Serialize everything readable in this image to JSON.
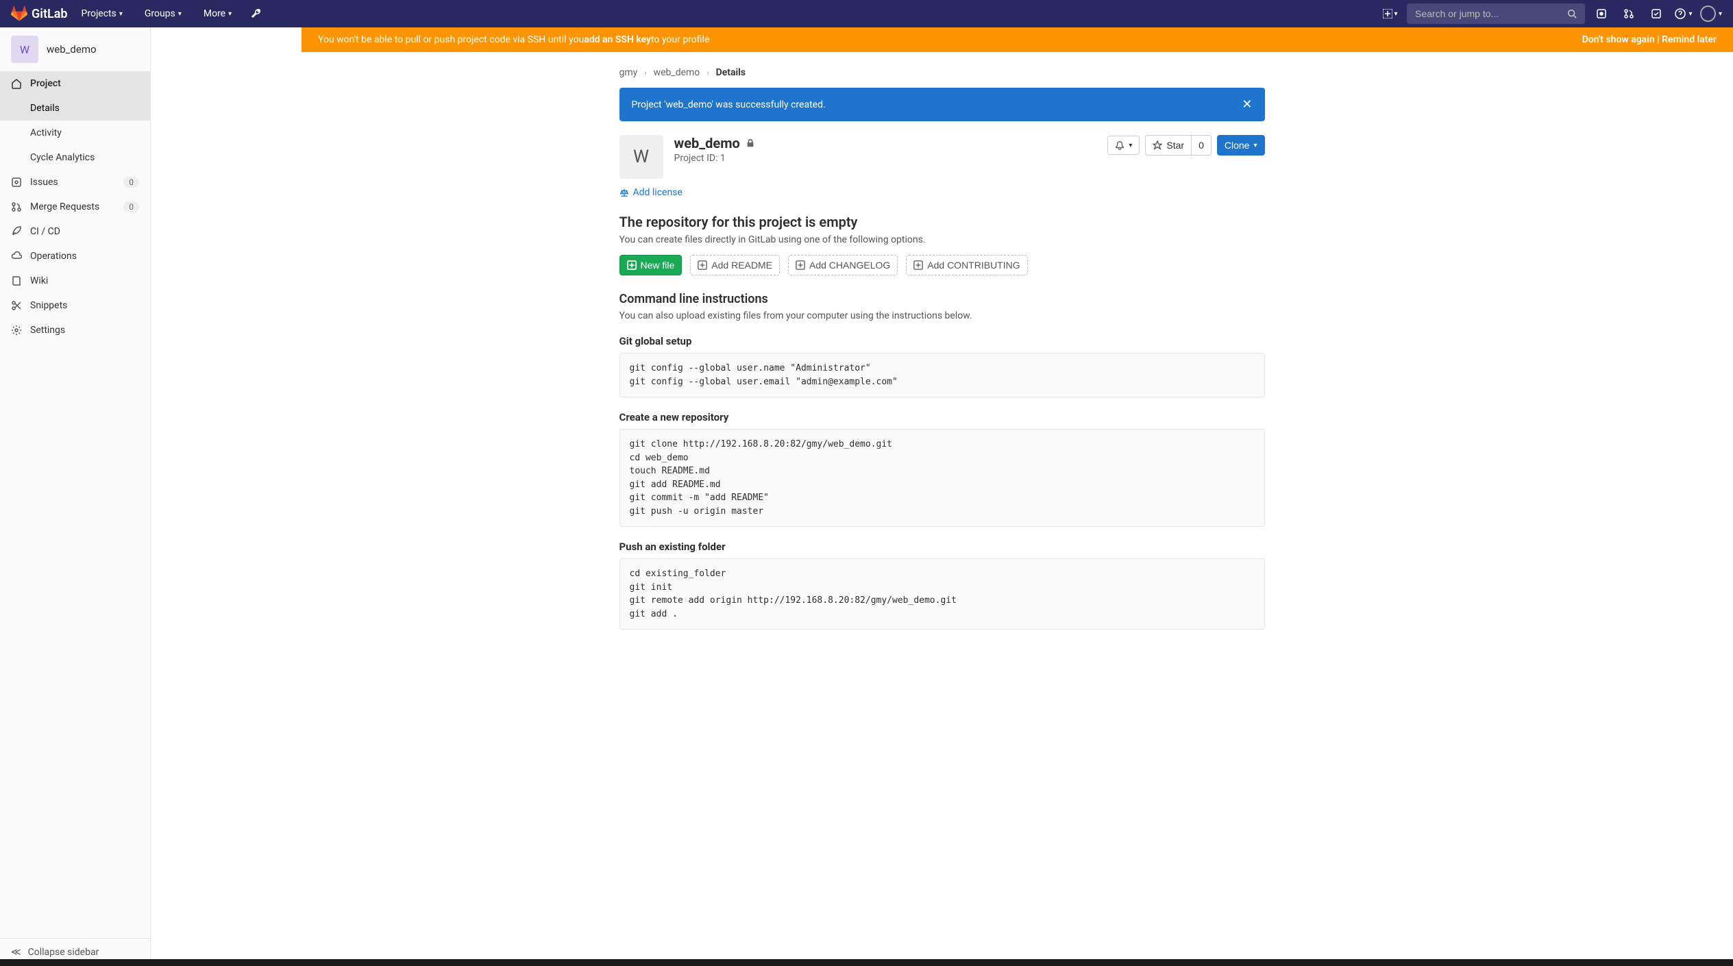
{
  "navbar": {
    "brand": "GitLab",
    "projects": "Projects",
    "groups": "Groups",
    "more": "More",
    "search_placeholder": "Search or jump to..."
  },
  "ssh_banner": {
    "prefix": "You won't be able to pull or push project code via SSH until you ",
    "link": "add an SSH key",
    "suffix": " to your profile",
    "dont_show": "Don't show again",
    "remind": "Remind later"
  },
  "sidebar": {
    "avatar_letter": "W",
    "project_name": "web_demo",
    "items": {
      "project": "Project",
      "details": "Details",
      "activity": "Activity",
      "cycle_analytics": "Cycle Analytics",
      "issues": "Issues",
      "issues_count": "0",
      "merge_requests": "Merge Requests",
      "mr_count": "0",
      "cicd": "CI / CD",
      "operations": "Operations",
      "wiki": "Wiki",
      "snippets": "Snippets",
      "settings": "Settings"
    },
    "collapse": "Collapse sidebar"
  },
  "breadcrumbs": {
    "owner": "gmy",
    "project": "web_demo",
    "current": "Details"
  },
  "alert": {
    "message": "Project 'web_demo' was successfully created."
  },
  "project": {
    "avatar_letter": "W",
    "name": "web_demo",
    "id_label": "Project ID: 1",
    "star_label": "Star",
    "star_count": "0",
    "clone_label": "Clone",
    "add_license": "Add license"
  },
  "empty_repo": {
    "heading": "The repository for this project is empty",
    "desc": "You can create files directly in GitLab using one of the following options.",
    "new_file": "New file",
    "add_readme": "Add README",
    "add_changelog": "Add CHANGELOG",
    "add_contributing": "Add CONTRIBUTING"
  },
  "cli": {
    "heading": "Command line instructions",
    "desc": "You can also upload existing files from your computer using the instructions below.",
    "global_setup_heading": "Git global setup",
    "global_setup_code": "git config --global user.name \"Administrator\"\ngit config --global user.email \"admin@example.com\"",
    "new_repo_heading": "Create a new repository",
    "new_repo_code": "git clone http://192.168.8.20:82/gmy/web_demo.git\ncd web_demo\ntouch README.md\ngit add README.md\ngit commit -m \"add README\"\ngit push -u origin master",
    "existing_heading": "Push an existing folder",
    "existing_code": "cd existing_folder\ngit init\ngit remote add origin http://192.168.8.20:82/gmy/web_demo.git\ngit add ."
  }
}
